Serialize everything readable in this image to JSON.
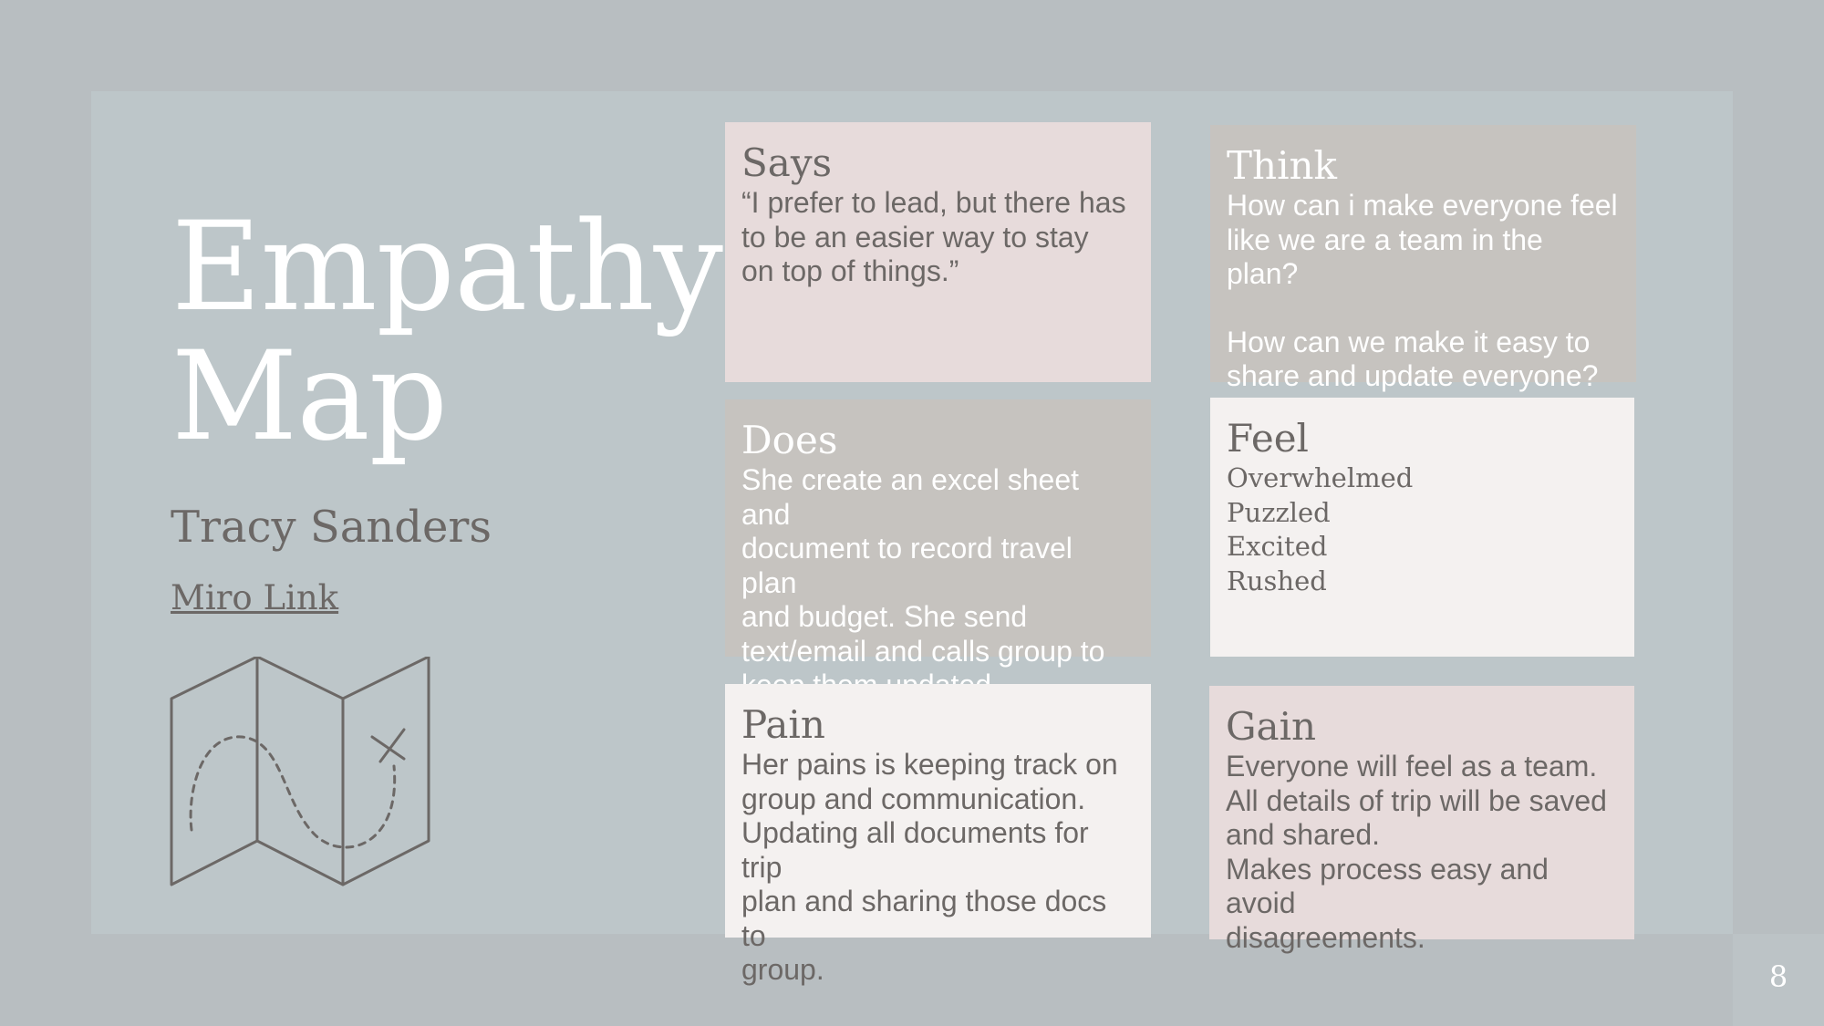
{
  "title_line1": "Empathy",
  "title_line2": "Map",
  "subtitle": "Tracy Sanders",
  "link_text": "Miro Link",
  "page_number": "8",
  "icon": "folded-map-icon",
  "cards": {
    "says": {
      "heading": "Says",
      "lines": [
        "“I prefer to lead, but there has",
        "to be an easier way to stay",
        "on top of things.”"
      ]
    },
    "think": {
      "heading": "Think",
      "lines": [
        "How can i make everyone feel",
        "like we are a team in the plan?",
        "How can we make it easy to",
        "share and update everyone?"
      ]
    },
    "does": {
      "heading": "Does",
      "lines": [
        "She create an excel sheet and",
        "document to record travel plan",
        "and budget. She send",
        "text/email and calls group to",
        "keep them updated."
      ]
    },
    "feel": {
      "heading": "Feel",
      "lines": [
        "Overwhelmed",
        "Puzzled",
        "Excited",
        "Rushed"
      ]
    },
    "pain": {
      "heading": "Pain",
      "lines": [
        "Her pains is keeping track on",
        "group and communication.",
        "Updating all documents for trip",
        "plan and sharing those docs to",
        "group."
      ]
    },
    "gain": {
      "heading": "Gain",
      "lines": [
        "Everyone will feel as a team.",
        "All details of trip will be saved",
        "and shared.",
        "Makes process easy and avoid",
        "disagreements."
      ]
    }
  },
  "colors": {
    "background": "#b8bec1",
    "panel": "#bdc6c9",
    "pink": "#e7dbdb",
    "grey": "#c6c3bf",
    "offwhite": "#f4f1f0",
    "text_dark": "#6c6866",
    "text_light": "#ffffff"
  }
}
